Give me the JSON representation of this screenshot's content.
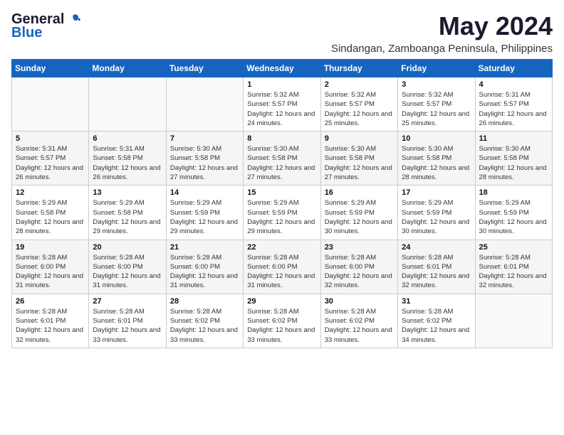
{
  "header": {
    "logo_general": "General",
    "logo_blue": "Blue",
    "month_year": "May 2024",
    "location": "Sindangan, Zamboanga Peninsula, Philippines"
  },
  "weekdays": [
    "Sunday",
    "Monday",
    "Tuesday",
    "Wednesday",
    "Thursday",
    "Friday",
    "Saturday"
  ],
  "weeks": [
    [
      {
        "day": "",
        "sunrise": "",
        "sunset": "",
        "daylight": ""
      },
      {
        "day": "",
        "sunrise": "",
        "sunset": "",
        "daylight": ""
      },
      {
        "day": "",
        "sunrise": "",
        "sunset": "",
        "daylight": ""
      },
      {
        "day": "1",
        "sunrise": "Sunrise: 5:32 AM",
        "sunset": "Sunset: 5:57 PM",
        "daylight": "Daylight: 12 hours and 24 minutes."
      },
      {
        "day": "2",
        "sunrise": "Sunrise: 5:32 AM",
        "sunset": "Sunset: 5:57 PM",
        "daylight": "Daylight: 12 hours and 25 minutes."
      },
      {
        "day": "3",
        "sunrise": "Sunrise: 5:32 AM",
        "sunset": "Sunset: 5:57 PM",
        "daylight": "Daylight: 12 hours and 25 minutes."
      },
      {
        "day": "4",
        "sunrise": "Sunrise: 5:31 AM",
        "sunset": "Sunset: 5:57 PM",
        "daylight": "Daylight: 12 hours and 26 minutes."
      }
    ],
    [
      {
        "day": "5",
        "sunrise": "Sunrise: 5:31 AM",
        "sunset": "Sunset: 5:57 PM",
        "daylight": "Daylight: 12 hours and 26 minutes."
      },
      {
        "day": "6",
        "sunrise": "Sunrise: 5:31 AM",
        "sunset": "Sunset: 5:58 PM",
        "daylight": "Daylight: 12 hours and 26 minutes."
      },
      {
        "day": "7",
        "sunrise": "Sunrise: 5:30 AM",
        "sunset": "Sunset: 5:58 PM",
        "daylight": "Daylight: 12 hours and 27 minutes."
      },
      {
        "day": "8",
        "sunrise": "Sunrise: 5:30 AM",
        "sunset": "Sunset: 5:58 PM",
        "daylight": "Daylight: 12 hours and 27 minutes."
      },
      {
        "day": "9",
        "sunrise": "Sunrise: 5:30 AM",
        "sunset": "Sunset: 5:58 PM",
        "daylight": "Daylight: 12 hours and 27 minutes."
      },
      {
        "day": "10",
        "sunrise": "Sunrise: 5:30 AM",
        "sunset": "Sunset: 5:58 PM",
        "daylight": "Daylight: 12 hours and 28 minutes."
      },
      {
        "day": "11",
        "sunrise": "Sunrise: 5:30 AM",
        "sunset": "Sunset: 5:58 PM",
        "daylight": "Daylight: 12 hours and 28 minutes."
      }
    ],
    [
      {
        "day": "12",
        "sunrise": "Sunrise: 5:29 AM",
        "sunset": "Sunset: 5:58 PM",
        "daylight": "Daylight: 12 hours and 28 minutes."
      },
      {
        "day": "13",
        "sunrise": "Sunrise: 5:29 AM",
        "sunset": "Sunset: 5:58 PM",
        "daylight": "Daylight: 12 hours and 29 minutes."
      },
      {
        "day": "14",
        "sunrise": "Sunrise: 5:29 AM",
        "sunset": "Sunset: 5:59 PM",
        "daylight": "Daylight: 12 hours and 29 minutes."
      },
      {
        "day": "15",
        "sunrise": "Sunrise: 5:29 AM",
        "sunset": "Sunset: 5:59 PM",
        "daylight": "Daylight: 12 hours and 29 minutes."
      },
      {
        "day": "16",
        "sunrise": "Sunrise: 5:29 AM",
        "sunset": "Sunset: 5:59 PM",
        "daylight": "Daylight: 12 hours and 30 minutes."
      },
      {
        "day": "17",
        "sunrise": "Sunrise: 5:29 AM",
        "sunset": "Sunset: 5:59 PM",
        "daylight": "Daylight: 12 hours and 30 minutes."
      },
      {
        "day": "18",
        "sunrise": "Sunrise: 5:29 AM",
        "sunset": "Sunset: 5:59 PM",
        "daylight": "Daylight: 12 hours and 30 minutes."
      }
    ],
    [
      {
        "day": "19",
        "sunrise": "Sunrise: 5:28 AM",
        "sunset": "Sunset: 6:00 PM",
        "daylight": "Daylight: 12 hours and 31 minutes."
      },
      {
        "day": "20",
        "sunrise": "Sunrise: 5:28 AM",
        "sunset": "Sunset: 6:00 PM",
        "daylight": "Daylight: 12 hours and 31 minutes."
      },
      {
        "day": "21",
        "sunrise": "Sunrise: 5:28 AM",
        "sunset": "Sunset: 6:00 PM",
        "daylight": "Daylight: 12 hours and 31 minutes."
      },
      {
        "day": "22",
        "sunrise": "Sunrise: 5:28 AM",
        "sunset": "Sunset: 6:00 PM",
        "daylight": "Daylight: 12 hours and 31 minutes."
      },
      {
        "day": "23",
        "sunrise": "Sunrise: 5:28 AM",
        "sunset": "Sunset: 6:00 PM",
        "daylight": "Daylight: 12 hours and 32 minutes."
      },
      {
        "day": "24",
        "sunrise": "Sunrise: 5:28 AM",
        "sunset": "Sunset: 6:01 PM",
        "daylight": "Daylight: 12 hours and 32 minutes."
      },
      {
        "day": "25",
        "sunrise": "Sunrise: 5:28 AM",
        "sunset": "Sunset: 6:01 PM",
        "daylight": "Daylight: 12 hours and 32 minutes."
      }
    ],
    [
      {
        "day": "26",
        "sunrise": "Sunrise: 5:28 AM",
        "sunset": "Sunset: 6:01 PM",
        "daylight": "Daylight: 12 hours and 32 minutes."
      },
      {
        "day": "27",
        "sunrise": "Sunrise: 5:28 AM",
        "sunset": "Sunset: 6:01 PM",
        "daylight": "Daylight: 12 hours and 33 minutes."
      },
      {
        "day": "28",
        "sunrise": "Sunrise: 5:28 AM",
        "sunset": "Sunset: 6:02 PM",
        "daylight": "Daylight: 12 hours and 33 minutes."
      },
      {
        "day": "29",
        "sunrise": "Sunrise: 5:28 AM",
        "sunset": "Sunset: 6:02 PM",
        "daylight": "Daylight: 12 hours and 33 minutes."
      },
      {
        "day": "30",
        "sunrise": "Sunrise: 5:28 AM",
        "sunset": "Sunset: 6:02 PM",
        "daylight": "Daylight: 12 hours and 33 minutes."
      },
      {
        "day": "31",
        "sunrise": "Sunrise: 5:28 AM",
        "sunset": "Sunset: 6:02 PM",
        "daylight": "Daylight: 12 hours and 34 minutes."
      },
      {
        "day": "",
        "sunrise": "",
        "sunset": "",
        "daylight": ""
      }
    ]
  ]
}
